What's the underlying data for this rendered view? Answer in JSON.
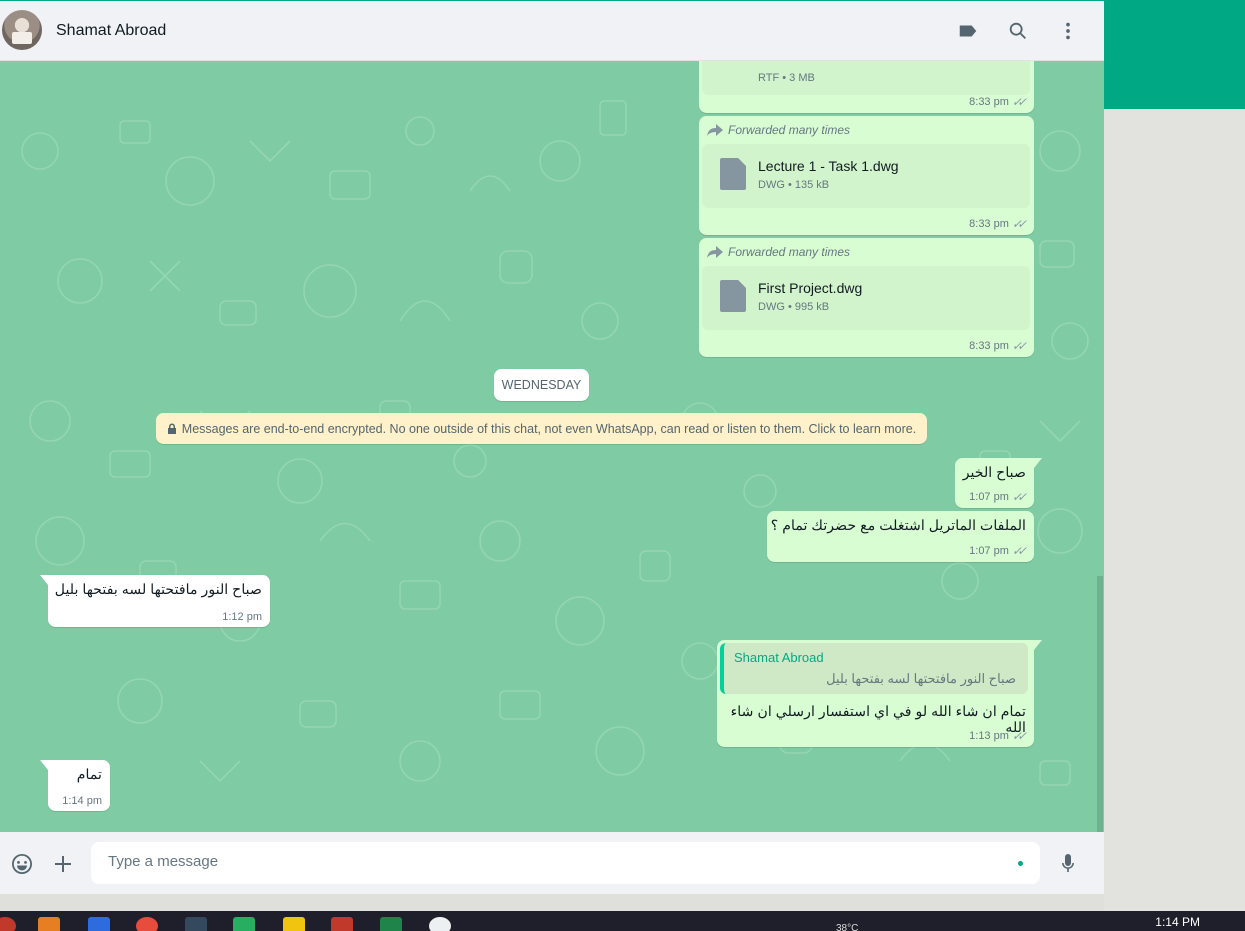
{
  "header": {
    "contact_name": "Shamat Abroad",
    "icons": [
      "label-icon",
      "search-icon",
      "menu-icon"
    ]
  },
  "messages": {
    "top_partial": {
      "info": "RTF • 3 MB",
      "time": "8:33 pm"
    },
    "file1": {
      "forward": "Forwarded many times",
      "name": "Lecture 1 - Task 1.dwg",
      "info": "DWG • 135 kB",
      "time": "8:33 pm"
    },
    "file2": {
      "forward": "Forwarded many times",
      "name": "First Project.dwg",
      "info": "DWG • 995 kB",
      "time": "8:33 pm"
    },
    "date_divider": "WEDNESDAY",
    "encryption_notice": "Messages are end-to-end encrypted. No one outside of this chat, not even WhatsApp, can read or listen to them. Click to learn more.",
    "m1": {
      "text": "صباح الخير",
      "time": "1:07 pm"
    },
    "m2": {
      "text": "الملفات الماتريل اشتغلت مع حضرتك تمام ؟",
      "time": "1:07 pm"
    },
    "m3": {
      "text": "صباح النور مافتحتها لسه بفتحها بليل",
      "time": "1:12 pm"
    },
    "m4": {
      "quote_name": "Shamat Abroad",
      "quote_text": "صباح النور مافتحتها لسه بفتحها بليل",
      "text": "تمام ان شاء الله لو في اي استفسار ارسلي ان شاء الله",
      "time": "1:13 pm"
    },
    "m5": {
      "text": "تمام",
      "time": "1:14 pm"
    }
  },
  "composer": {
    "placeholder": "Type a message",
    "icons": [
      "emoji-icon",
      "attach-plus-icon",
      "microphone-icon"
    ]
  },
  "taskbar": {
    "time": "1:14 PM",
    "temp": "38°C"
  },
  "colors": {
    "accent": "#00a884",
    "outgoing_bubble": "#d9fdd3",
    "incoming_bubble": "#ffffff",
    "chat_bg": "#7fcba4"
  }
}
